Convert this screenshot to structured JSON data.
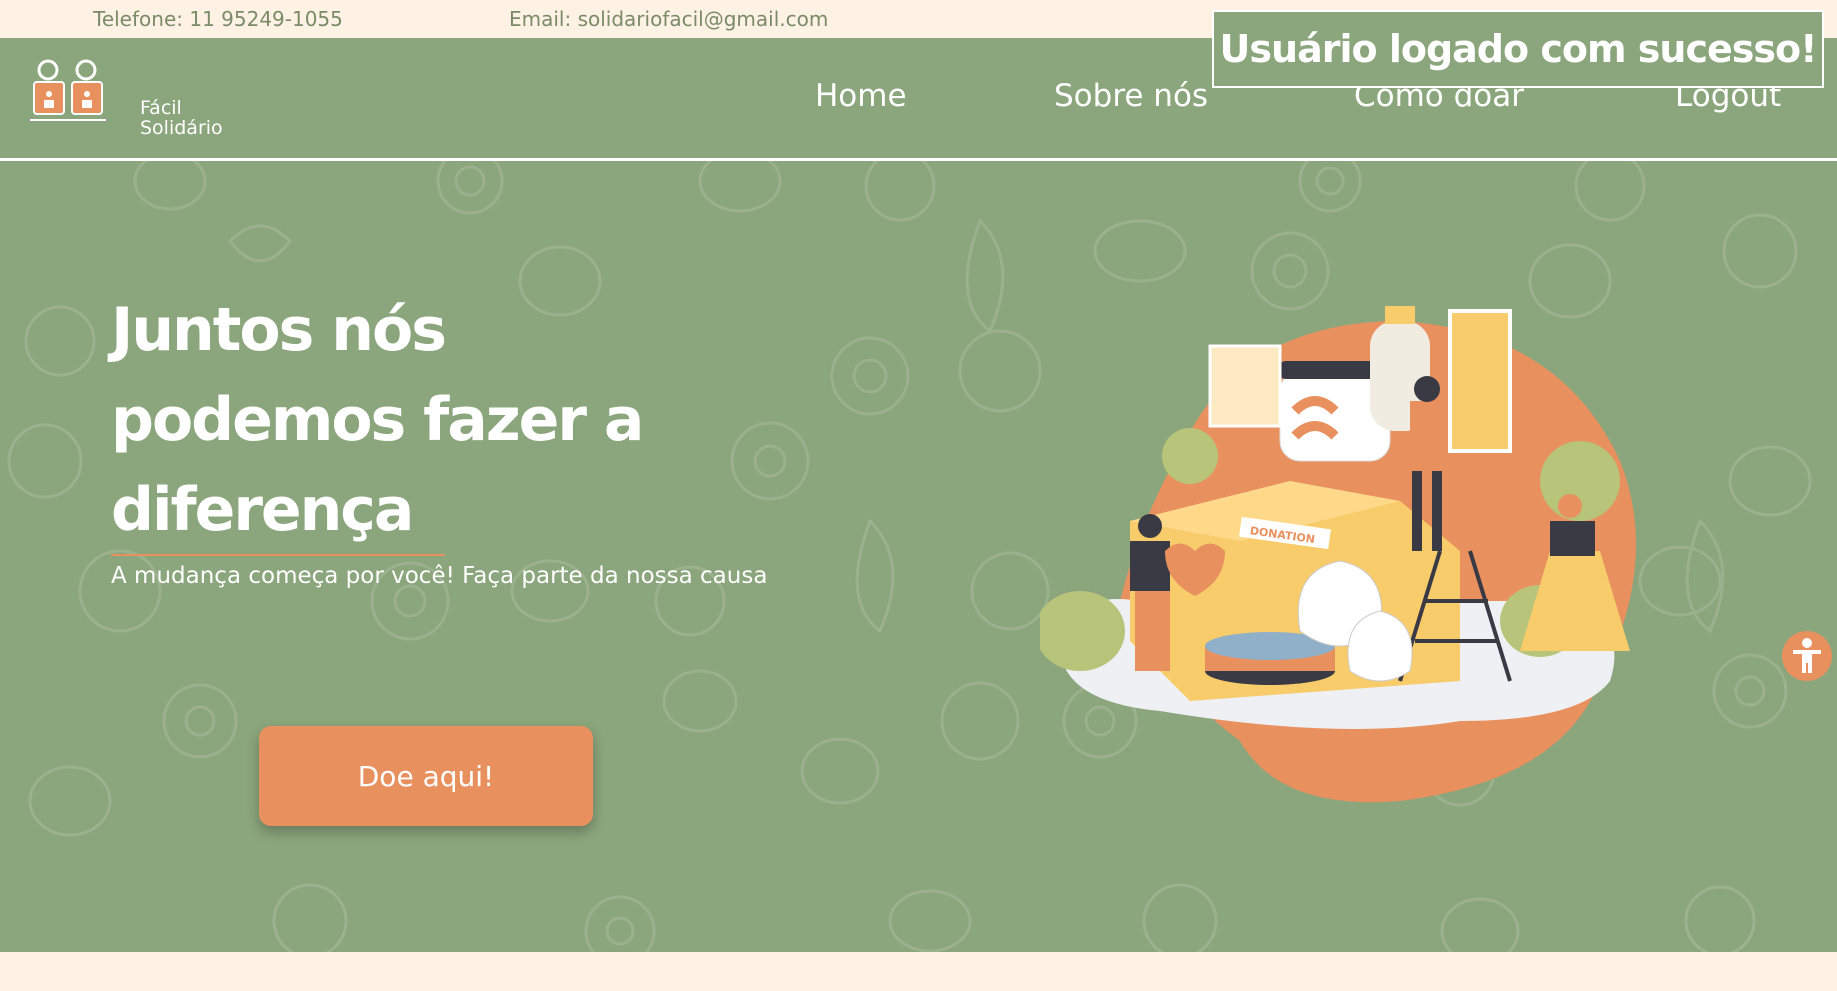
{
  "topbar": {
    "phone": "Telefone: 11 95249-1055",
    "email": "Email: solidariofacil@gmail.com"
  },
  "brand": {
    "line1": "Fácil",
    "line2": "Solidário",
    "logo_icon": "two-people-heart-logo"
  },
  "nav": {
    "home": "Home",
    "about": "Sobre nós",
    "how_to_donate": "Como doar",
    "logout": "Logout"
  },
  "toast": {
    "message": "Usuário logado com sucesso!"
  },
  "hero": {
    "headline_line1": "Juntos nós",
    "headline_line2": "podemos fazer a",
    "headline_line3": "diferença",
    "subtitle": "A mudança começa por você! Faça parte da nossa causa",
    "cta_label": "Doe aqui!",
    "illustration_label": "DONATION"
  },
  "icons": {
    "accessibility": "accessibility-icon"
  },
  "colors": {
    "primary_green": "#8ba57c",
    "accent_orange": "#e8915f",
    "cream": "#fdf2e3"
  }
}
